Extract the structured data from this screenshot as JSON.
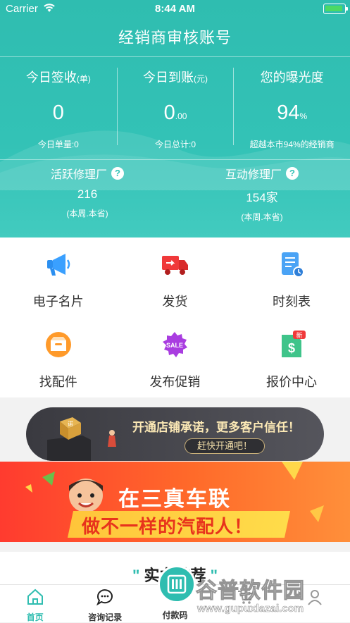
{
  "status_bar": {
    "carrier": "Carrier",
    "time": "8:44 AM"
  },
  "header": {
    "title": "经销商审核账号",
    "stats": [
      {
        "label": "今日签收",
        "unit": "(单)",
        "value": "0",
        "value_suffix": "",
        "sub": "今日单量:0"
      },
      {
        "label": "今日到账",
        "unit": "(元)",
        "value": "0",
        "value_suffix": ".00",
        "sub": "今日总计:0"
      },
      {
        "label": "您的曝光度",
        "unit": "",
        "value": "94",
        "value_suffix": "%",
        "sub": "超越本市94%的经销商"
      }
    ],
    "factories": [
      {
        "label": "活跃修理厂",
        "value": "216",
        "sub": "(本周.本省)"
      },
      {
        "label": "互动修理厂",
        "value": "154家",
        "sub": "(本周.本省)"
      }
    ],
    "help_glyph": "?"
  },
  "grid": [
    {
      "label": "电子名片",
      "icon": "megaphone-icon"
    },
    {
      "label": "发货",
      "icon": "delivery-truck-icon"
    },
    {
      "label": "时刻表",
      "icon": "schedule-icon"
    },
    {
      "label": "找配件",
      "icon": "parts-box-icon"
    },
    {
      "label": "发布促销",
      "icon": "sale-badge-icon"
    },
    {
      "label": "报价中心",
      "icon": "quote-price-icon",
      "badge": "新"
    }
  ],
  "banner_store": {
    "badge": "诺",
    "text": "开通店铺承诺，更多客户信任！",
    "button": "赶快开通吧！"
  },
  "banner_promo": {
    "line1": "在三真车联",
    "line2": "做不一样的汽配人！"
  },
  "recommend": {
    "title": "实力推荐"
  },
  "tabbar": [
    {
      "label": "首页",
      "icon": "home-icon",
      "active": true
    },
    {
      "label": "咨询记录",
      "icon": "chat-icon",
      "active": false
    },
    {
      "label": "付款码",
      "icon": "payment-code-icon",
      "active": false
    },
    {
      "label": "",
      "icon": "cart-icon",
      "active": false
    },
    {
      "label": "",
      "icon": "profile-icon",
      "active": false
    }
  ],
  "watermark": {
    "text": "谷普软件园",
    "url": "www.gupuxlazai.com"
  },
  "colors": {
    "primary": "#2fbdb0",
    "promo_red": "#ff3b2f",
    "promo_yellow": "#ffc53a",
    "dark_banner": "#3a3a40"
  }
}
